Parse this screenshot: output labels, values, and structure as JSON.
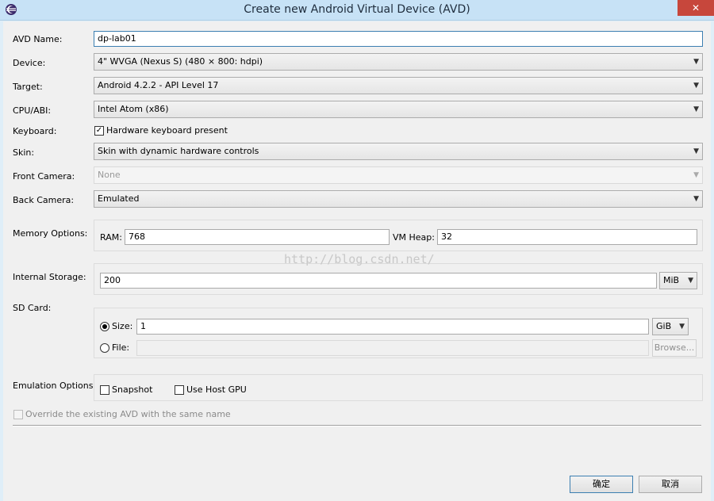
{
  "window": {
    "title": "Create new Android Virtual Device (AVD)",
    "close": "✕"
  },
  "form": {
    "avd_name": {
      "label": "AVD Name:",
      "value": "dp-lab01"
    },
    "device": {
      "label": "Device:",
      "value": "4\" WVGA (Nexus S) (480 × 800: hdpi)"
    },
    "target": {
      "label": "Target:",
      "value": "Android 4.2.2 - API Level 17"
    },
    "cpu_abi": {
      "label": "CPU/ABI:",
      "value": "Intel Atom (x86)"
    },
    "keyboard": {
      "label": "Keyboard:",
      "option": "Hardware keyboard present",
      "checked": true
    },
    "skin": {
      "label": "Skin:",
      "value": "Skin with dynamic hardware controls"
    },
    "front_camera": {
      "label": "Front Camera:",
      "value": "None",
      "enabled": false
    },
    "back_camera": {
      "label": "Back Camera:",
      "value": "Emulated"
    },
    "memory": {
      "label": "Memory Options:",
      "ram_label": "RAM:",
      "ram": "768",
      "vm_heap_label": "VM Heap:",
      "vm_heap": "32"
    },
    "internal_storage": {
      "label": "Internal Storage:",
      "value": "200",
      "unit": "MiB"
    },
    "sd_card": {
      "label": "SD Card:",
      "size_label": "Size:",
      "size": "1",
      "size_unit": "GiB",
      "file_label": "File:",
      "file": "",
      "browse": "Browse...",
      "selected": "size"
    },
    "emulation": {
      "label": "Emulation Options:",
      "snapshot": "Snapshot",
      "use_host_gpu": "Use Host GPU"
    },
    "override": {
      "label": "Override the existing AVD with the same name",
      "enabled": false
    }
  },
  "buttons": {
    "ok": "确定",
    "cancel": "取消"
  },
  "watermark": "http://blog.csdn.net/"
}
